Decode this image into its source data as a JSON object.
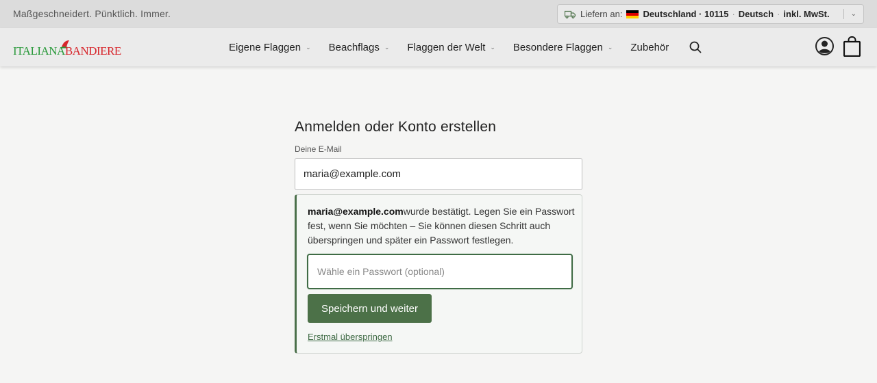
{
  "topbar": {
    "tagline": "Maßgeschneidert. Pünktlich. Immer.",
    "deliver_label": "Liefern an:",
    "country_zip": "Deutschland · 10115",
    "language": "Deutsch",
    "tax": "inkl. MwSt.",
    "separator": "·"
  },
  "header": {
    "logo": {
      "part1": "ITALIANA",
      "part2": "BANDIERE"
    },
    "nav": [
      {
        "label": "Eigene Flaggen",
        "has_dropdown": true
      },
      {
        "label": "Beachflags",
        "has_dropdown": true
      },
      {
        "label": "Flaggen der Welt",
        "has_dropdown": true
      },
      {
        "label": "Besondere Flaggen",
        "has_dropdown": true
      },
      {
        "label": "Zubehör",
        "has_dropdown": false
      }
    ],
    "icons": [
      "search-icon",
      "account-icon",
      "shopping-bag-icon"
    ]
  },
  "form": {
    "title": "Anmelden oder Konto erstellen",
    "email_label": "Deine E-Mail",
    "email_value": "maria@example.com",
    "confirm_email": "maria@example.com",
    "confirm_text": "wurde bestätigt. Legen Sie ein Passwort fest, wenn Sie möchten – Sie können diesen Schritt auch überspringen und später ein Passwort festlegen.",
    "password_placeholder": "Wähle ein Passwort (optional)",
    "save_button": "Speichern und weiter",
    "skip_link": "Erstmal überspringen"
  },
  "colors": {
    "accent_green": "#4c7148",
    "logo_green": "#2b9a3c",
    "logo_red": "#d7262c"
  }
}
